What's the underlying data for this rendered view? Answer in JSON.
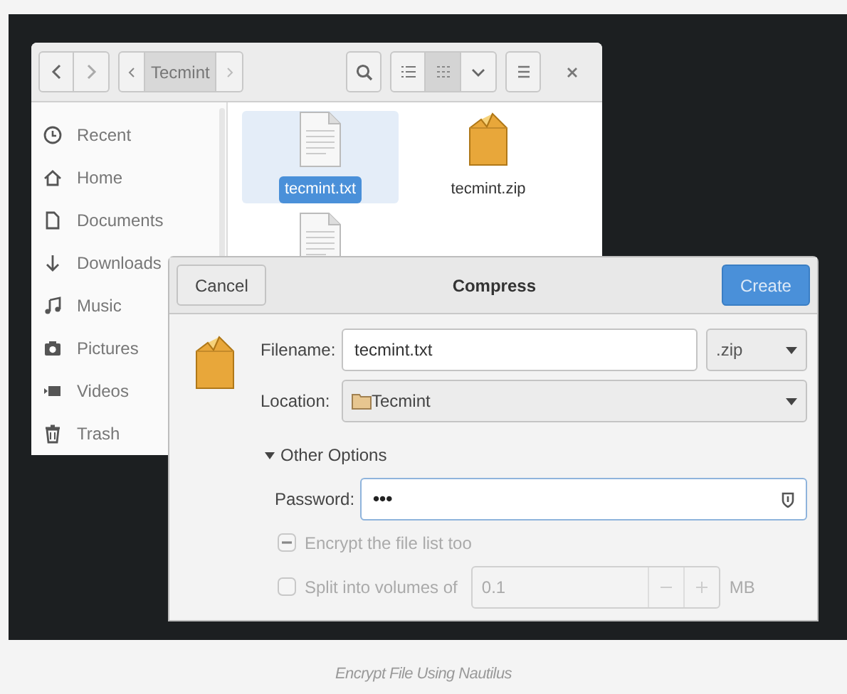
{
  "file_manager": {
    "path_button": "Tecmint",
    "view_buttons": [
      {
        "kind": "list",
        "selected": false
      },
      {
        "kind": "grid",
        "selected": true
      }
    ],
    "sidebar": {
      "items": [
        {
          "label": "Recent"
        },
        {
          "label": "Home"
        },
        {
          "label": "Documents"
        },
        {
          "label": "Downloads"
        },
        {
          "label": "Music"
        },
        {
          "label": "Pictures"
        },
        {
          "label": "Videos"
        },
        {
          "label": "Trash"
        }
      ]
    },
    "files": [
      {
        "name": "tecmint.txt",
        "kind": "text",
        "selected": true
      },
      {
        "name": "tecmint.zip",
        "kind": "archive",
        "selected": false
      },
      {
        "kind": "text",
        "selected": false
      }
    ]
  },
  "dialog": {
    "title": "Compress",
    "cancel": "Cancel",
    "create": "Create",
    "filename_label": "Filename:",
    "filename": "tecmint.txt",
    "extension": ".zip",
    "location_label": "Location:",
    "location": "Tecmint",
    "other_options": {
      "label": "Other Options",
      "expanded": true
    },
    "password_label": "Password:",
    "password": "•••",
    "options": [
      {
        "label": "Encrypt the file list too",
        "checked": false,
        "indeterminate": true,
        "disabled": true
      },
      {
        "label": "Split into volumes of",
        "checked": false,
        "indeterminate": false,
        "disabled": true
      }
    ],
    "volume_size": "0.1",
    "volume_unit": "MB"
  },
  "caption": "Encrypt File Using Nautilus"
}
